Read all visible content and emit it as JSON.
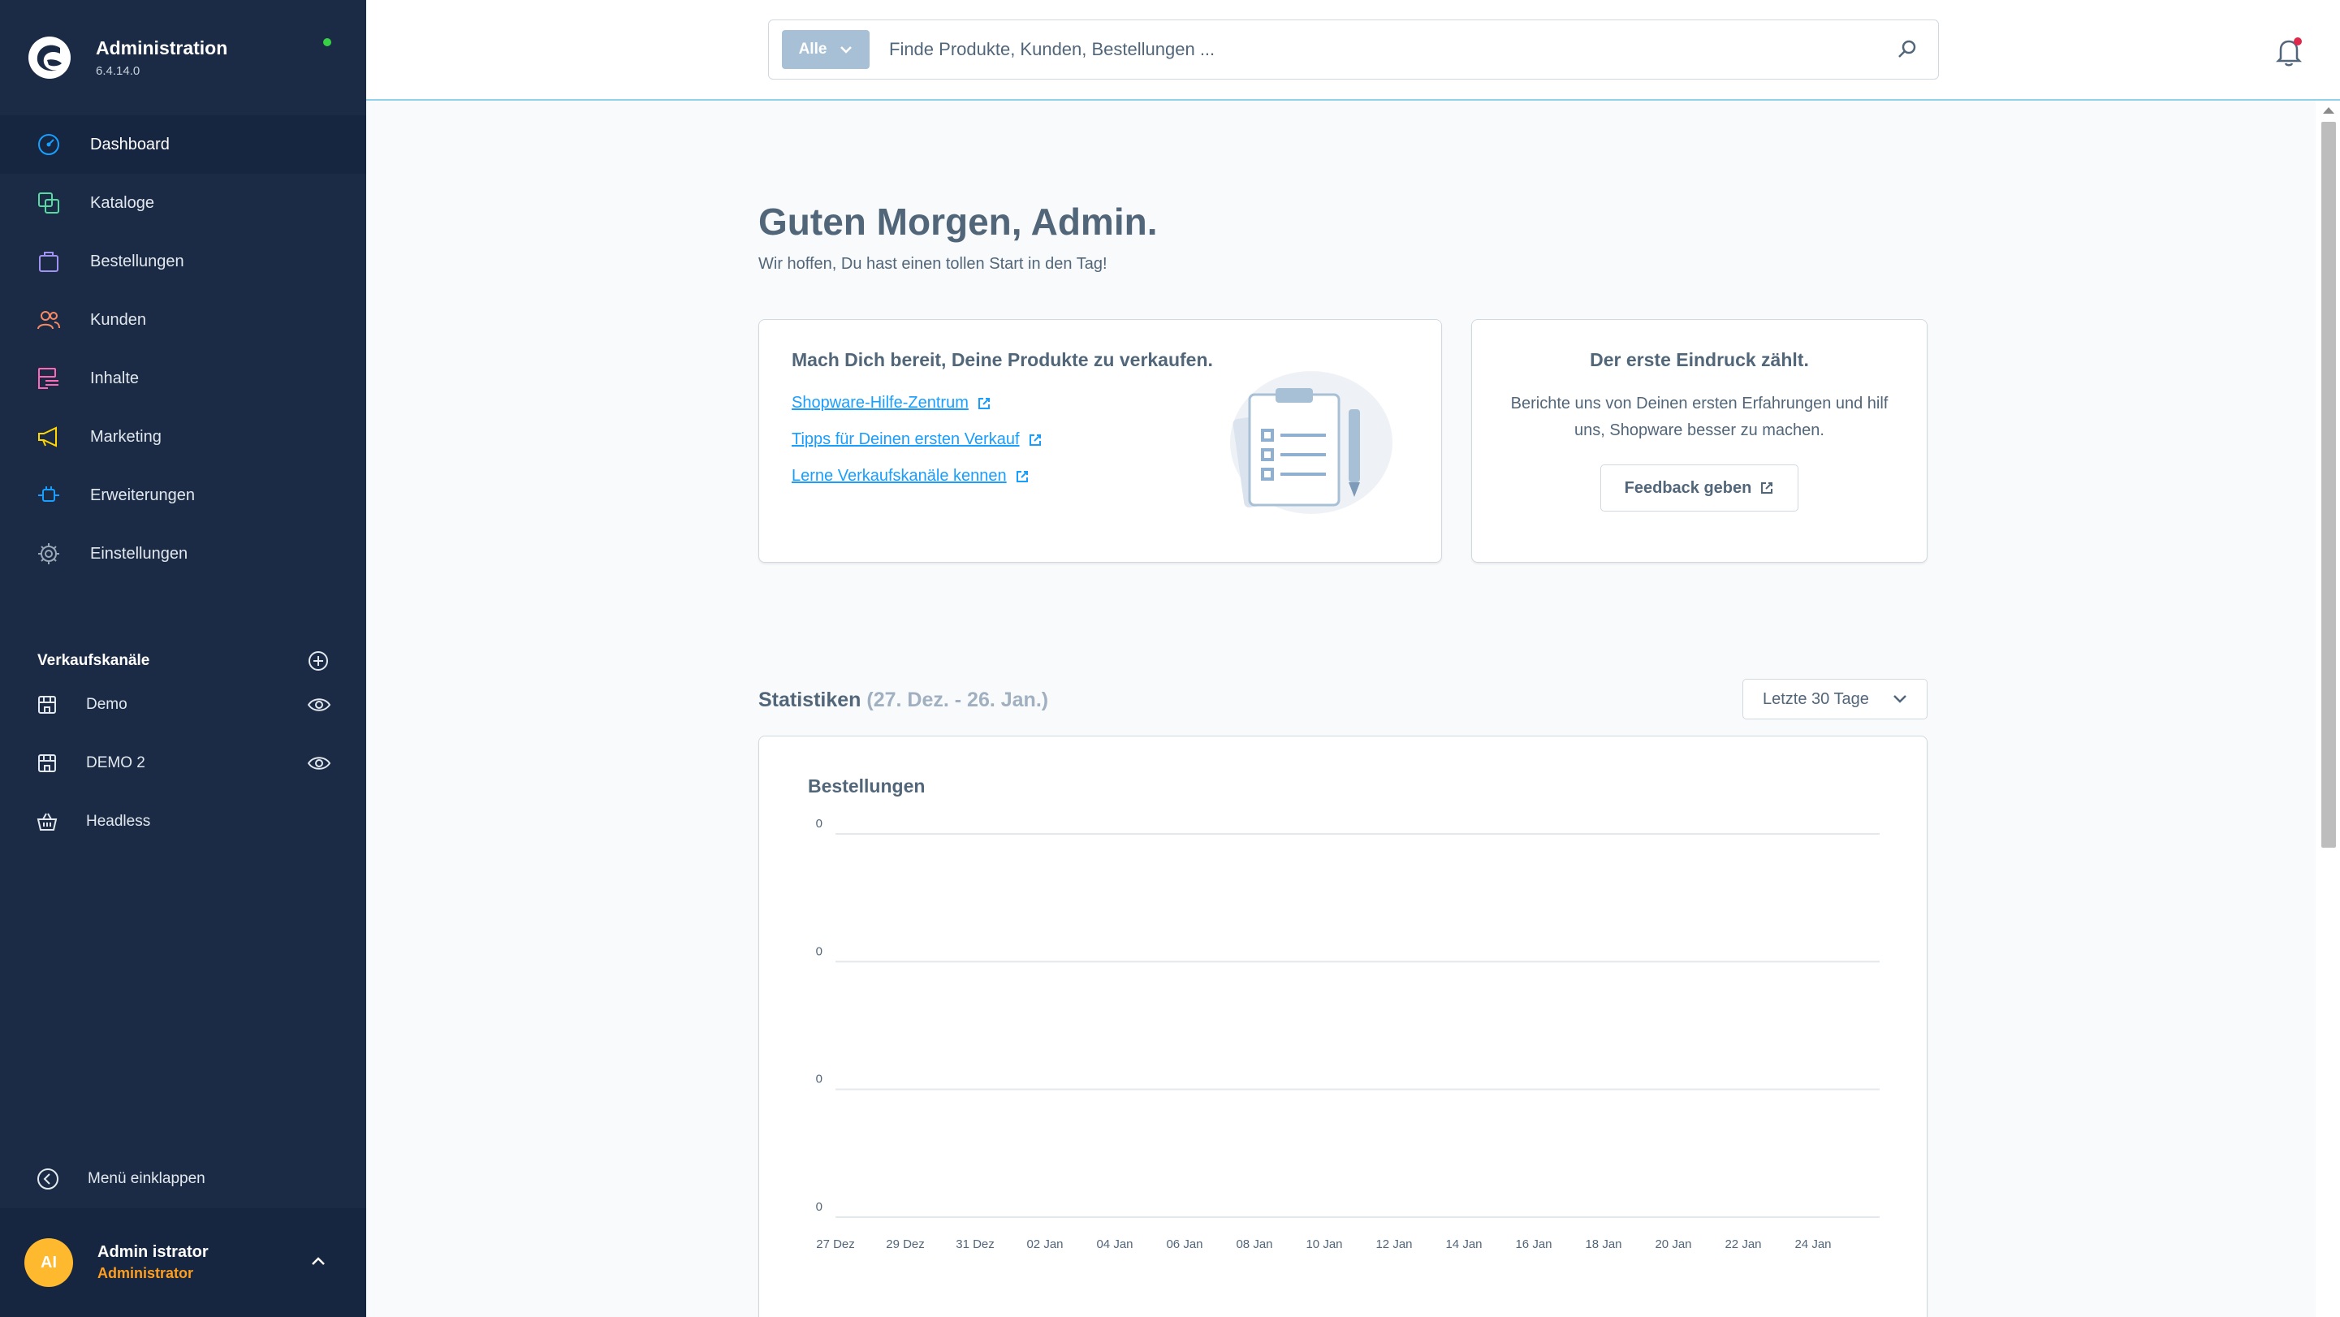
{
  "app": {
    "title": "Administration",
    "version": "6.4.14.0"
  },
  "nav": [
    {
      "label": "Dashboard",
      "icon": "dashboard-icon",
      "color": "#189eff",
      "active": true
    },
    {
      "label": "Kataloge",
      "icon": "catalog-icon",
      "color": "#57d9a3"
    },
    {
      "label": "Bestellungen",
      "icon": "orders-icon",
      "color": "#a092f0"
    },
    {
      "label": "Kunden",
      "icon": "customers-icon",
      "color": "#f88962"
    },
    {
      "label": "Inhalte",
      "icon": "content-icon",
      "color": "#ff68b4"
    },
    {
      "label": "Marketing",
      "icon": "marketing-icon",
      "color": "#ffd700"
    },
    {
      "label": "Erweiterungen",
      "icon": "extensions-icon",
      "color": "#189eff"
    },
    {
      "label": "Einstellungen",
      "icon": "settings-icon",
      "color": "#9aa8b5"
    }
  ],
  "sales_channels": {
    "title": "Verkaufskanäle",
    "items": [
      {
        "label": "Demo",
        "icon": "storefront-icon",
        "visible": true
      },
      {
        "label": "DEMO 2",
        "icon": "storefront-icon",
        "visible": true
      },
      {
        "label": "Headless",
        "icon": "basket-icon",
        "visible": false
      }
    ]
  },
  "collapse_label": "Menü einklappen",
  "user": {
    "initials": "AI",
    "name": "Admin istrator",
    "role": "Administrator"
  },
  "search": {
    "type_label": "Alle",
    "placeholder": "Finde Produkte, Kunden, Bestellungen ..."
  },
  "greeting": {
    "title": "Guten Morgen, Admin.",
    "subtitle": "Wir hoffen, Du hast einen tollen Start in den Tag!"
  },
  "getting_started": {
    "title": "Mach Dich bereit, Deine Produkte zu verkaufen.",
    "links": [
      "Shopware-Hilfe-Zentrum",
      "Tipps für Deinen ersten Verkauf",
      "Lerne Verkaufskanäle kennen"
    ]
  },
  "feedback": {
    "title": "Der erste Eindruck zählt.",
    "text": "Berichte uns von Deinen ersten Erfahrungen und hilf uns, Shopware besser zu machen.",
    "button": "Feedback geben"
  },
  "statistics": {
    "title": "Statistiken",
    "range": "(27. Dez. - 26. Jan.)",
    "range_select": "Letzte 30 Tage"
  },
  "chart_data": {
    "type": "line",
    "title": "Bestellungen",
    "x": [
      "27 Dez",
      "29 Dez",
      "31 Dez",
      "02 Jan",
      "04 Jan",
      "06 Jan",
      "08 Jan",
      "10 Jan",
      "12 Jan",
      "14 Jan",
      "16 Jan",
      "18 Jan",
      "20 Jan",
      "22 Jan",
      "24 Jan"
    ],
    "y_ticks": [
      "0",
      "0",
      "0",
      "0"
    ],
    "series": [],
    "grid": true
  },
  "colors": {
    "sidebar": "#1b2b45",
    "accent": "#189eff",
    "status_online": "#37d046",
    "avatar": "#ffb92e",
    "role": "#ff9e1e"
  }
}
